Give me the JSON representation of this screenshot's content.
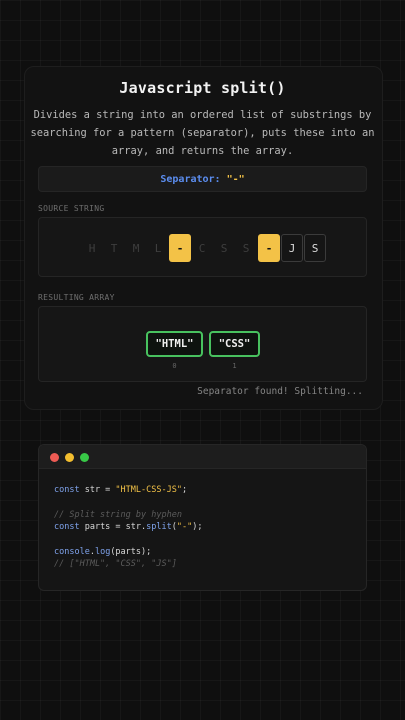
{
  "header": {
    "title": "Javascript split()",
    "description": "Divides a string into an ordered list of substrings by searching for a pattern (separator), puts these into an array, and returns the array."
  },
  "separator": {
    "label": "Separator:",
    "value": "\"-\""
  },
  "source": {
    "label": "SOURCE STRING",
    "chars": [
      "H",
      "T",
      "M",
      "L",
      "-",
      "C",
      "S",
      "S",
      "-",
      "J",
      "S"
    ]
  },
  "result": {
    "label": "RESULTING ARRAY",
    "items": [
      "\"HTML\"",
      "\"CSS\""
    ],
    "indices": [
      "0",
      "1"
    ]
  },
  "status": "Separator found! Splitting...",
  "colors": {
    "accent_yellow": "#f3c247",
    "accent_green": "#48c25f",
    "keyword_blue": "#7fa3ec",
    "dot_red": "#ed5b54",
    "dot_yellow": "#f3be2f",
    "dot_green": "#38c847"
  },
  "code": {
    "line1": {
      "kw": "const",
      "text1": " str = ",
      "str": "\"HTML-CSS-JS\"",
      "end": ";"
    },
    "line2": {
      "comment": "// Split string by hyphen"
    },
    "line3": {
      "kw": "const",
      "text1": " parts = str.",
      "fn": "split",
      "open": "(",
      "str": "\"-\"",
      "end": ");"
    },
    "line4": {
      "obj": "console",
      "dot": ".",
      "fn": "log",
      "rest": "(parts);"
    },
    "line5": {
      "comment": "// [\"HTML\", \"CSS\", \"JS\"]"
    }
  }
}
